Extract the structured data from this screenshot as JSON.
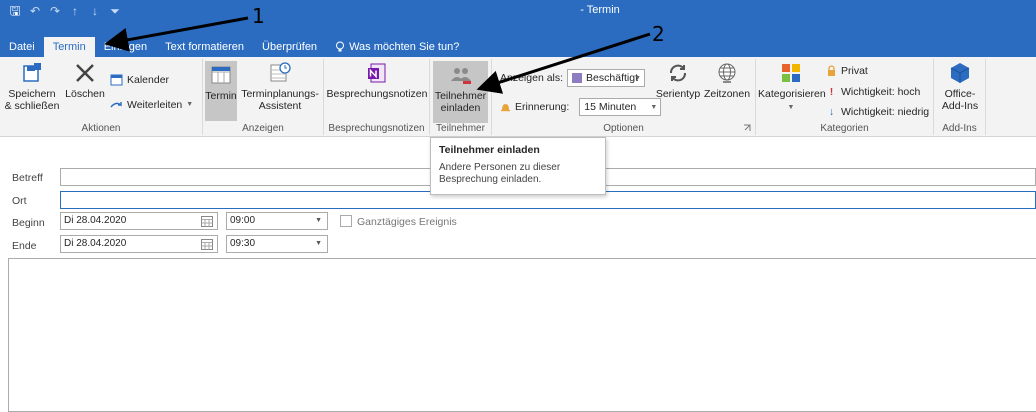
{
  "window": {
    "title": "- Termin"
  },
  "tabs": [
    {
      "label": "Datei"
    },
    {
      "label": "Termin"
    },
    {
      "label": "Einfügen"
    },
    {
      "label": "Text formatieren"
    },
    {
      "label": "Überprüfen"
    },
    {
      "label": "Was möchten Sie tun?"
    }
  ],
  "ribbon": {
    "aktionen": {
      "label": "Aktionen",
      "save_line1": "Speichern",
      "save_line2": "& schließen",
      "delete": "Löschen",
      "calendar": "Kalender",
      "forward": "Weiterleiten"
    },
    "anzeigen": {
      "label": "Anzeigen",
      "termin": "Termin",
      "assistant_line1": "Terminplanungs-",
      "assistant_line2": "Assistent"
    },
    "notes": {
      "label": "Besprechungsnotizen",
      "button": "Besprechungsnotizen"
    },
    "teilnehmer": {
      "label": "Teilnehmer",
      "invite_line1": "Teilnehmer",
      "invite_line2": "einladen"
    },
    "optionen": {
      "label": "Optionen",
      "show_as_label": "Anzeigen als:",
      "show_as_value": "Beschäftigt",
      "reminder_label": "Erinnerung:",
      "reminder_value": "15 Minuten",
      "recurrence": "Serientyp",
      "timezones": "Zeitzonen"
    },
    "kategorien": {
      "label": "Kategorien",
      "categorize": "Kategorisieren",
      "private": "Privat",
      "high": "Wichtigkeit: hoch",
      "low": "Wichtigkeit: niedrig"
    },
    "addins": {
      "label": "Add-Ins",
      "line1": "Office-",
      "line2": "Add-Ins"
    }
  },
  "tooltip": {
    "title": "Teilnehmer einladen",
    "line1": "Andere Personen zu dieser",
    "line2": "Besprechung einladen."
  },
  "form": {
    "subject_label": "Betreff",
    "location_label": "Ort",
    "start_label": "Beginn",
    "end_label": "Ende",
    "start_date": "Di 28.04.2020",
    "start_time": "09:00",
    "end_date": "Di 28.04.2020",
    "end_time": "09:30",
    "allday_label": "Ganztägiges Ereignis"
  },
  "annotations": {
    "one": "1",
    "two": "2"
  },
  "colors": {
    "accent": "#2b6cc0",
    "busy": "#8e7cc3"
  }
}
